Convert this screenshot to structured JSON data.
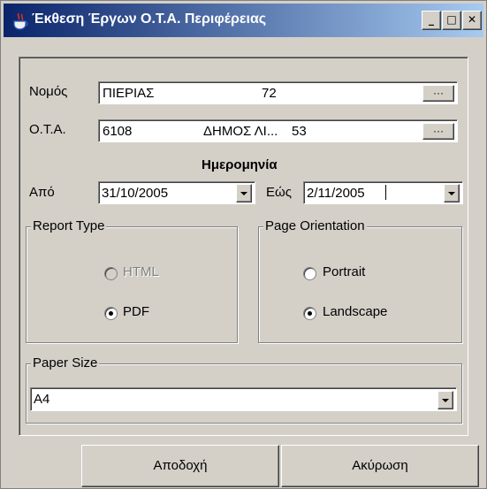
{
  "window": {
    "title": "Έκθεση Έργων Ο.Τ.Α. Περιφέρειας",
    "minimize_glyph": "_",
    "maximize_glyph": "□",
    "close_glyph": "✕"
  },
  "form": {
    "nomos_label": "Νομός",
    "nomos_name": "ΠΙΕΡΙΑΣ",
    "nomos_code": "72",
    "ota_label": "Ο.Τ.Α.",
    "ota_code": "6108",
    "ota_name": "ΔΗΜΟΣ ΛΙ...",
    "ota_number": "53",
    "browse_label": "···",
    "date_heading": "Ημερομηνία",
    "from_label": "Από",
    "from_value": "31/10/2005",
    "to_label": "Εώς",
    "to_value": "2/11/2005"
  },
  "report_type": {
    "title": "Report Type",
    "options": [
      {
        "label": "HTML",
        "selected": false,
        "enabled": false
      },
      {
        "label": "PDF",
        "selected": true,
        "enabled": true
      }
    ]
  },
  "page_orientation": {
    "title": "Page Orientation",
    "options": [
      {
        "label": "Portrait",
        "selected": false
      },
      {
        "label": "Landscape",
        "selected": true
      }
    ]
  },
  "paper_size": {
    "title": "Paper Size",
    "value": "A4"
  },
  "buttons": {
    "accept": "Αποδοχή",
    "cancel": "Ακύρωση"
  }
}
